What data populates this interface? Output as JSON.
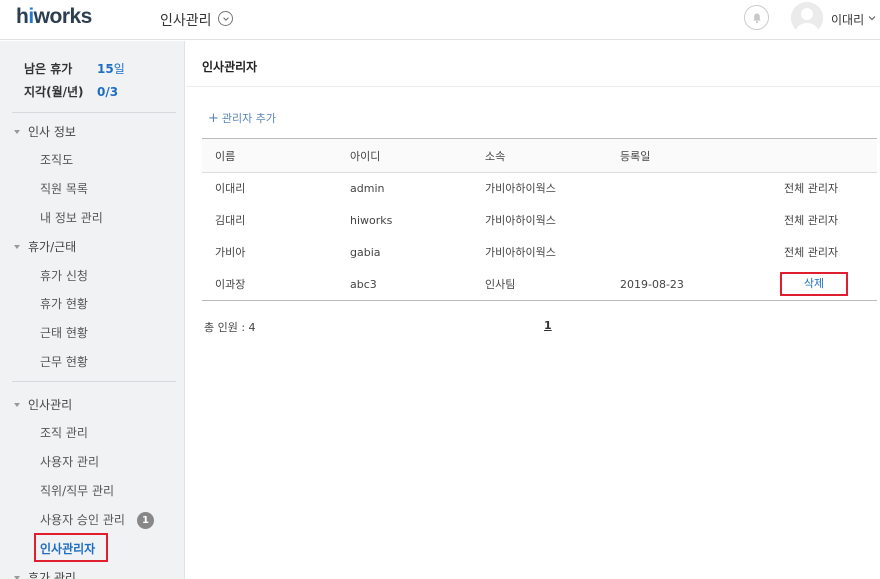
{
  "header": {
    "logo_hi": "h",
    "logo_i": "i",
    "logo_rest": "works",
    "app_title": "인사관리",
    "user_name": "이대리"
  },
  "sidebar": {
    "leave": [
      {
        "label": "남은 휴가",
        "value": "15",
        "unit": "일"
      },
      {
        "label": "지각(월/년)",
        "value": "0/3",
        "unit": ""
      }
    ],
    "sections": [
      {
        "title": "인사 정보",
        "items": [
          "조직도",
          "직원 목록",
          "내 정보 관리"
        ]
      },
      {
        "title": "휴가/근태",
        "items": [
          "휴가 신청",
          "휴가 현황",
          "근태 현황",
          "근무 현황"
        ]
      },
      {
        "title": "인사관리",
        "items": [
          "조직 관리",
          "사용자 관리",
          "직위/직무 관리",
          "사용자 승인 관리",
          "인사관리자"
        ]
      },
      {
        "title": "휴가 관리",
        "items": []
      }
    ],
    "approval_badge": "1"
  },
  "main": {
    "title": "인사관리자",
    "add_label": "관리자 추가",
    "columns": [
      "이름",
      "아이디",
      "소속",
      "등록일",
      ""
    ],
    "rows": [
      {
        "name": "이대리",
        "id": "admin",
        "dept": "가비아하이웍스",
        "date": "",
        "role": "전체 관리자"
      },
      {
        "name": "김대리",
        "id": "hiworks",
        "dept": "가비아하이웍스",
        "date": "",
        "role": "전체 관리자"
      },
      {
        "name": "가비아",
        "id": "gabia",
        "dept": "가비아하이웍스",
        "date": "",
        "role": "전체 관리자"
      },
      {
        "name": "이과장",
        "id": "abc3",
        "dept": "인사팀",
        "date": "2019-08-23",
        "role": "삭제"
      }
    ],
    "total_label": "총 인원 : 4",
    "page": "1"
  },
  "colors": {
    "accent": "#1e6fc4",
    "highlight_border": "#e01e2e",
    "sidebar_bg": "#f1f2f4"
  }
}
